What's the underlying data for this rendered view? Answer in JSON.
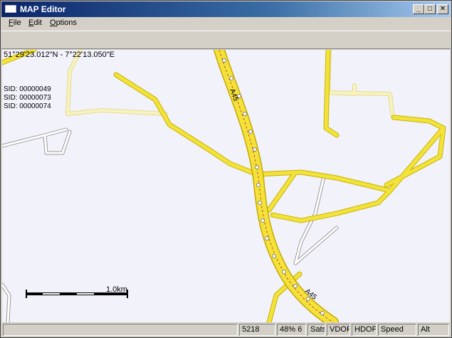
{
  "window": {
    "title": "MAP Editor"
  },
  "menu": {
    "file": "F",
    "file_rest": "ile",
    "edit": "E",
    "edit_rest": "dit",
    "options": "O",
    "options_rest": "ptions"
  },
  "titlebar_buttons": {
    "minimize": "_",
    "maximize": "□",
    "close": "✕"
  },
  "map": {
    "coordinates": "51°29'23.012\"N  -  7°22'13.050\"E",
    "sids": [
      "SID: 00000049",
      "SID: 00000073",
      "SID: 00000074"
    ],
    "road_label": "A45",
    "scale_label": "1.0km",
    "colors": {
      "background": "#f2f2fb",
      "road_main": "#f2e23a",
      "road_edge": "#c8a800",
      "road_minor": "#f5f0b0",
      "highway_center": "#d4442c"
    }
  },
  "status": {
    "cell1": "",
    "cell2": "5218",
    "cell3": "48% 6",
    "sats": "Sats",
    "vdop": "VDOP",
    "hdop": "HDOP",
    "speed": "Speed",
    "alt": "Alt"
  }
}
